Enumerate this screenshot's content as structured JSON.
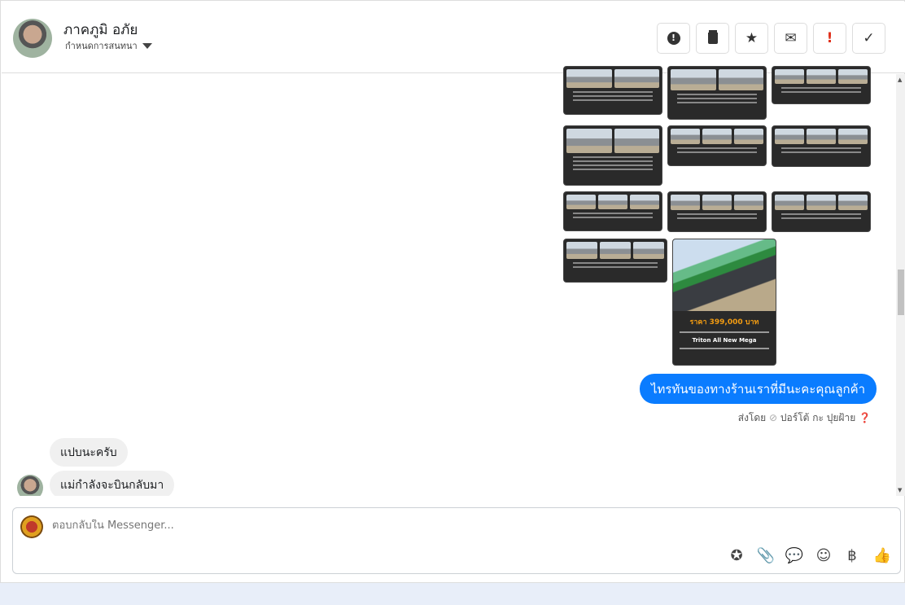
{
  "header": {
    "name": "ภาคภูมิ อภัย",
    "subtitle": "กำหนดการสนทนา",
    "buttons": [
      {
        "icon": "alert-circle-icon",
        "glyph": "●"
      },
      {
        "icon": "trash-icon",
        "glyph": "🗑"
      },
      {
        "icon": "star-icon",
        "glyph": "★"
      },
      {
        "icon": "envelope-icon",
        "glyph": "✉"
      },
      {
        "icon": "exclamation-icon",
        "glyph": "!"
      },
      {
        "icon": "check-icon",
        "glyph": "✓"
      }
    ]
  },
  "product_card": {
    "price": "ราคา 399,000 บาท",
    "model": "Triton All New Mega"
  },
  "messages": {
    "outgoing": "ไทรทันของทางร้านเราที่มีนะคะคุณลูกค้า",
    "sent_by_label": "ส่งโดย",
    "sender": "ปอร์โต้ กะ ปุยฝ้าย",
    "incoming": [
      "แปบนะครับ",
      "แม่กำลังจะบินกลับมา"
    ]
  },
  "composer": {
    "placeholder": "ตอบกลับใน Messenger...",
    "icons": [
      {
        "name": "saved-reply-icon",
        "glyph": "✪"
      },
      {
        "name": "attachment-icon",
        "glyph": "📎"
      },
      {
        "name": "chat-bubble-icon",
        "glyph": "💬"
      },
      {
        "name": "emoji-icon",
        "glyph": "☺"
      },
      {
        "name": "baht-icon",
        "glyph": "฿"
      },
      {
        "name": "thumbs-up-icon",
        "glyph": "👍"
      }
    ]
  },
  "colors": {
    "accent": "#0a7cff"
  }
}
